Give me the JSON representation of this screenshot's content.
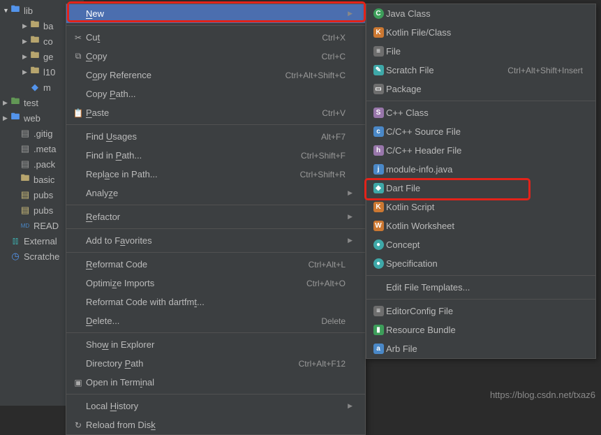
{
  "tree": {
    "items": [
      {
        "arrow": "▼",
        "arrowOpen": true,
        "icon": "folder-blue",
        "label": "lib",
        "indent": 0
      },
      {
        "arrow": "▶",
        "icon": "folder",
        "label": "ba",
        "indent": 2
      },
      {
        "arrow": "▶",
        "icon": "folder",
        "label": "co",
        "indent": 2
      },
      {
        "arrow": "▶",
        "icon": "folder",
        "label": "ge",
        "indent": 2
      },
      {
        "arrow": "▶",
        "icon": "folder",
        "label": "l10",
        "indent": 2
      },
      {
        "arrow": "",
        "icon": "file-blue",
        "label": "m",
        "indent": 2
      },
      {
        "arrow": "▶",
        "icon": "folder-green",
        "label": "test",
        "indent": 0
      },
      {
        "arrow": "▶",
        "icon": "folder-blue",
        "label": "web",
        "indent": 0
      },
      {
        "arrow": "",
        "icon": "file-g",
        "label": ".gitig",
        "indent": 1
      },
      {
        "arrow": "",
        "icon": "file-g",
        "label": ".meta",
        "indent": 1
      },
      {
        "arrow": "",
        "icon": "file-g",
        "label": ".pack",
        "indent": 1
      },
      {
        "arrow": "",
        "icon": "folder",
        "label": "basic",
        "indent": 1
      },
      {
        "arrow": "",
        "icon": "file-y",
        "label": "pubs",
        "indent": 1
      },
      {
        "arrow": "",
        "icon": "file-y",
        "label": "pubs",
        "indent": 1
      },
      {
        "arrow": "",
        "icon": "file-md",
        "label": "READ",
        "indent": 1
      },
      {
        "arrow": "",
        "icon": "chart",
        "label": "External",
        "indent": 0
      },
      {
        "arrow": "",
        "icon": "clock",
        "label": "Scratche",
        "indent": 0
      }
    ]
  },
  "menu1": [
    {
      "icon": "",
      "label": "<u>N</u>ew",
      "shortcut": "",
      "sub": true,
      "hover": true
    },
    {
      "sep": true
    },
    {
      "icon": "✂",
      "label": "Cu<u>t</u>",
      "shortcut": "Ctrl+X"
    },
    {
      "icon": "⧉",
      "label": "<u>C</u>opy",
      "shortcut": "Ctrl+C"
    },
    {
      "icon": "",
      "label": "C<u>o</u>py Reference",
      "shortcut": "Ctrl+Alt+Shift+C"
    },
    {
      "icon": "",
      "label": "Copy <u>P</u>ath...",
      "shortcut": ""
    },
    {
      "icon": "📋",
      "label": "<u>P</u>aste",
      "shortcut": "Ctrl+V"
    },
    {
      "sep": true
    },
    {
      "icon": "",
      "label": "Find <u>U</u>sages",
      "shortcut": "Alt+F7"
    },
    {
      "icon": "",
      "label": "Find in <u>P</u>ath...",
      "shortcut": "Ctrl+Shift+F"
    },
    {
      "icon": "",
      "label": "Repl<u>a</u>ce in Path...",
      "shortcut": "Ctrl+Shift+R"
    },
    {
      "icon": "",
      "label": "Analy<u>z</u>e",
      "shortcut": "",
      "sub": true
    },
    {
      "sep": true
    },
    {
      "icon": "",
      "label": "<u>R</u>efactor",
      "shortcut": "",
      "sub": true
    },
    {
      "sep": true
    },
    {
      "icon": "",
      "label": "Add to F<u>a</u>vorites",
      "shortcut": "",
      "sub": true
    },
    {
      "sep": true
    },
    {
      "icon": "",
      "label": "<u>R</u>eformat Code",
      "shortcut": "Ctrl+Alt+L"
    },
    {
      "icon": "",
      "label": "Optimi<u>z</u>e Imports",
      "shortcut": "Ctrl+Alt+O"
    },
    {
      "icon": "",
      "label": "Reformat Code with dartfm<u>t</u>...",
      "shortcut": ""
    },
    {
      "icon": "",
      "label": "<u>D</u>elete...",
      "shortcut": "Delete"
    },
    {
      "sep": true
    },
    {
      "icon": "",
      "label": "Sho<u>w</u> in Explorer",
      "shortcut": ""
    },
    {
      "icon": "",
      "label": "Directory <u>P</u>ath",
      "shortcut": "Ctrl+Alt+F12"
    },
    {
      "icon": "▣",
      "label": "Open in Term<u>i</u>nal",
      "shortcut": ""
    },
    {
      "sep": true
    },
    {
      "icon": "",
      "label": "Local <u>H</u>istory",
      "shortcut": "",
      "sub": true
    },
    {
      "icon": "↻",
      "label": "Reload from Dis<u>k</u>",
      "shortcut": ""
    }
  ],
  "menu2": [
    {
      "badge": "C",
      "bcls": "bg-green circ",
      "label": "Java Class",
      "shortcut": ""
    },
    {
      "badge": "K",
      "bcls": "bg-orange",
      "label": "Kotlin File/Class",
      "shortcut": ""
    },
    {
      "badge": "≡",
      "bcls": "bg-gray",
      "label": "File",
      "shortcut": ""
    },
    {
      "badge": "✎",
      "bcls": "bg-teal",
      "label": "Scratch File",
      "shortcut": "Ctrl+Alt+Shift+Insert"
    },
    {
      "badge": "▭",
      "bcls": "bg-gray",
      "label": "Package",
      "shortcut": ""
    },
    {
      "sep": true
    },
    {
      "badge": "S",
      "bcls": "bg-purple",
      "label": "C++ Class",
      "shortcut": ""
    },
    {
      "badge": "c",
      "bcls": "bg-blue",
      "label": "C/C++ Source File",
      "shortcut": ""
    },
    {
      "badge": "h",
      "bcls": "bg-purple",
      "label": "C/C++ Header File",
      "shortcut": ""
    },
    {
      "badge": "j",
      "bcls": "bg-blue",
      "label": "module-info.java",
      "shortcut": ""
    },
    {
      "badge": "◆",
      "bcls": "bg-teal",
      "label": "Dart File",
      "shortcut": ""
    },
    {
      "badge": "K",
      "bcls": "bg-orange",
      "label": "Kotlin Script",
      "shortcut": ""
    },
    {
      "badge": "W",
      "bcls": "bg-orange",
      "label": "Kotlin Worksheet",
      "shortcut": ""
    },
    {
      "badge": "●",
      "bcls": "bg-teal circ",
      "label": "Concept",
      "shortcut": ""
    },
    {
      "badge": "●",
      "bcls": "bg-teal circ",
      "label": "Specification",
      "shortcut": ""
    },
    {
      "sep": true
    },
    {
      "badge": "",
      "bcls": "",
      "label": "Edit File Templates...",
      "shortcut": ""
    },
    {
      "sep": true
    },
    {
      "badge": "≡",
      "bcls": "bg-gray",
      "label": "EditorConfig File",
      "shortcut": ""
    },
    {
      "badge": "▮",
      "bcls": "bg-green",
      "label": "Resource Bundle",
      "shortcut": ""
    },
    {
      "badge": "a",
      "bcls": "bg-blue",
      "label": "Arb File",
      "shortcut": ""
    }
  ],
  "watermark": "https://blog.csdn.net/txaz6"
}
